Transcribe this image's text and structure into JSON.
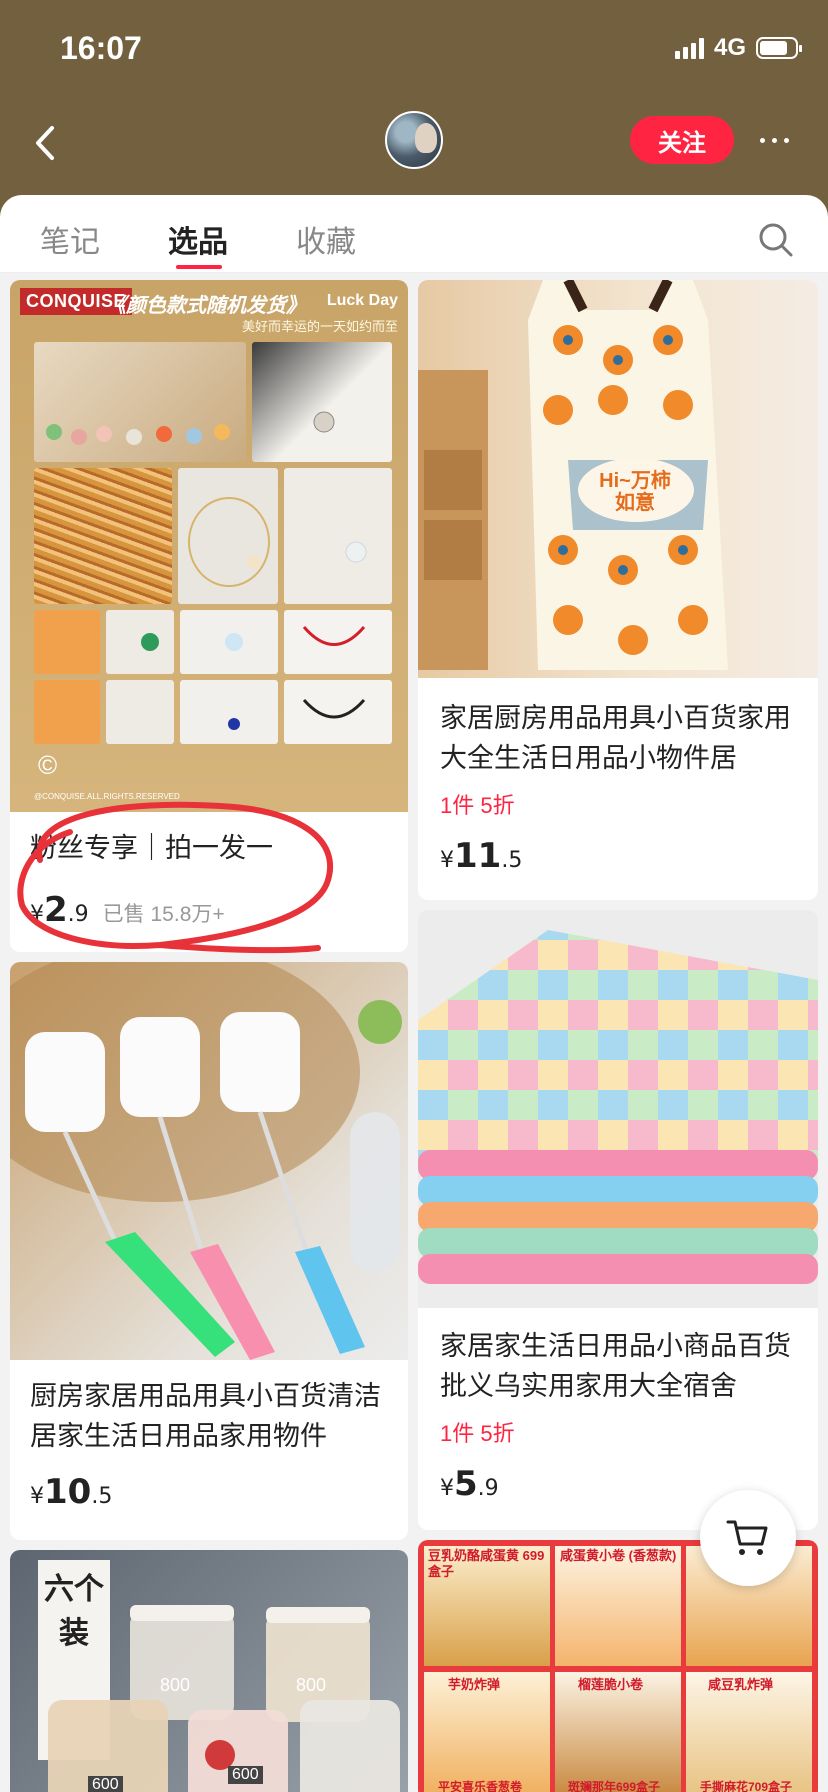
{
  "status_bar": {
    "time": "16:07",
    "network": "4G"
  },
  "header": {
    "follow_label": "关注"
  },
  "tabs": [
    {
      "label": "笔记",
      "active": false
    },
    {
      "label": "选品",
      "active": true
    },
    {
      "label": "收藏",
      "active": false
    }
  ],
  "products": [
    {
      "image": {
        "brand": "CONQUISE",
        "headline": "《颜色款式随机发货》",
        "tagline": "Luck Day",
        "subline": "美好而幸运的一天如约而至",
        "copyright": "©",
        "rights": "@CONQUISE.ALL.RIGHTS.RESERVED"
      },
      "title": "粉丝专享｜拍一发一",
      "price_symbol": "¥",
      "price_int": "2",
      "price_dec": ".9",
      "sold": "已售 15.8万+"
    },
    {
      "image": {
        "apron_text": "Hi~万柿如意"
      },
      "title": "家居厨房用品用具小百货家用大全生活日用品小物件居",
      "promo": "1件 5折",
      "price_symbol": "¥",
      "price_int": "11",
      "price_dec": ".5"
    },
    {
      "title": "厨房家居用品用具小百货清洁居家生活日用品家用物件",
      "price_symbol": "¥",
      "price_int": "10",
      "price_dec": ".5"
    },
    {
      "title": "家居家生活日用品小商品百货批义乌实用家用大全宿舍",
      "promo": "1件 5折",
      "price_symbol": "¥",
      "price_int": "5",
      "price_dec": ".9"
    },
    {
      "image": {
        "badge": "六个装",
        "label_1": "800",
        "label_2": "800",
        "label_3": "600",
        "label_4": "600"
      }
    },
    {
      "image": {
        "panels": [
          "豆乳奶酪咸蛋黄 699盒子",
          "咸蛋黄小卷 (香葱款)",
          "",
          "芋奶炸弹",
          "榴莲脆小卷",
          "咸豆乳炸弹"
        ],
        "bottom": [
          "平安喜乐香葱卷",
          "斑斓那年699盒子",
          "手撕麻花709盒子"
        ]
      }
    }
  ],
  "colors": {
    "header_bg": "#73603f",
    "accent": "#ff2442",
    "annotation": "#e8323a"
  }
}
